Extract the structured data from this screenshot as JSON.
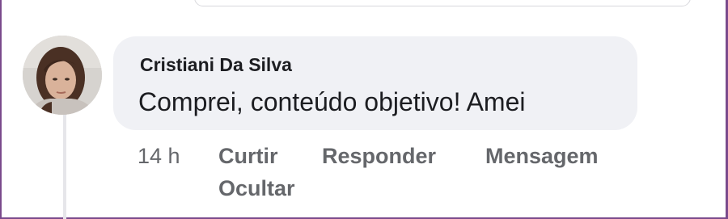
{
  "comment": {
    "author": "Cristiani Da Silva",
    "text": "Comprei, conteúdo objetivo! Amei",
    "timestamp": "14 h",
    "avatar_icon": "profile-photo-avatar"
  },
  "actions": {
    "like": "Curtir",
    "reply": "Responder",
    "message": "Mensagem",
    "hide": "Ocultar"
  },
  "colors": {
    "bubble_bg": "#f0f1f5",
    "text": "#1c1d21",
    "meta_text": "#65676b",
    "frame": "#7a4a8c"
  }
}
